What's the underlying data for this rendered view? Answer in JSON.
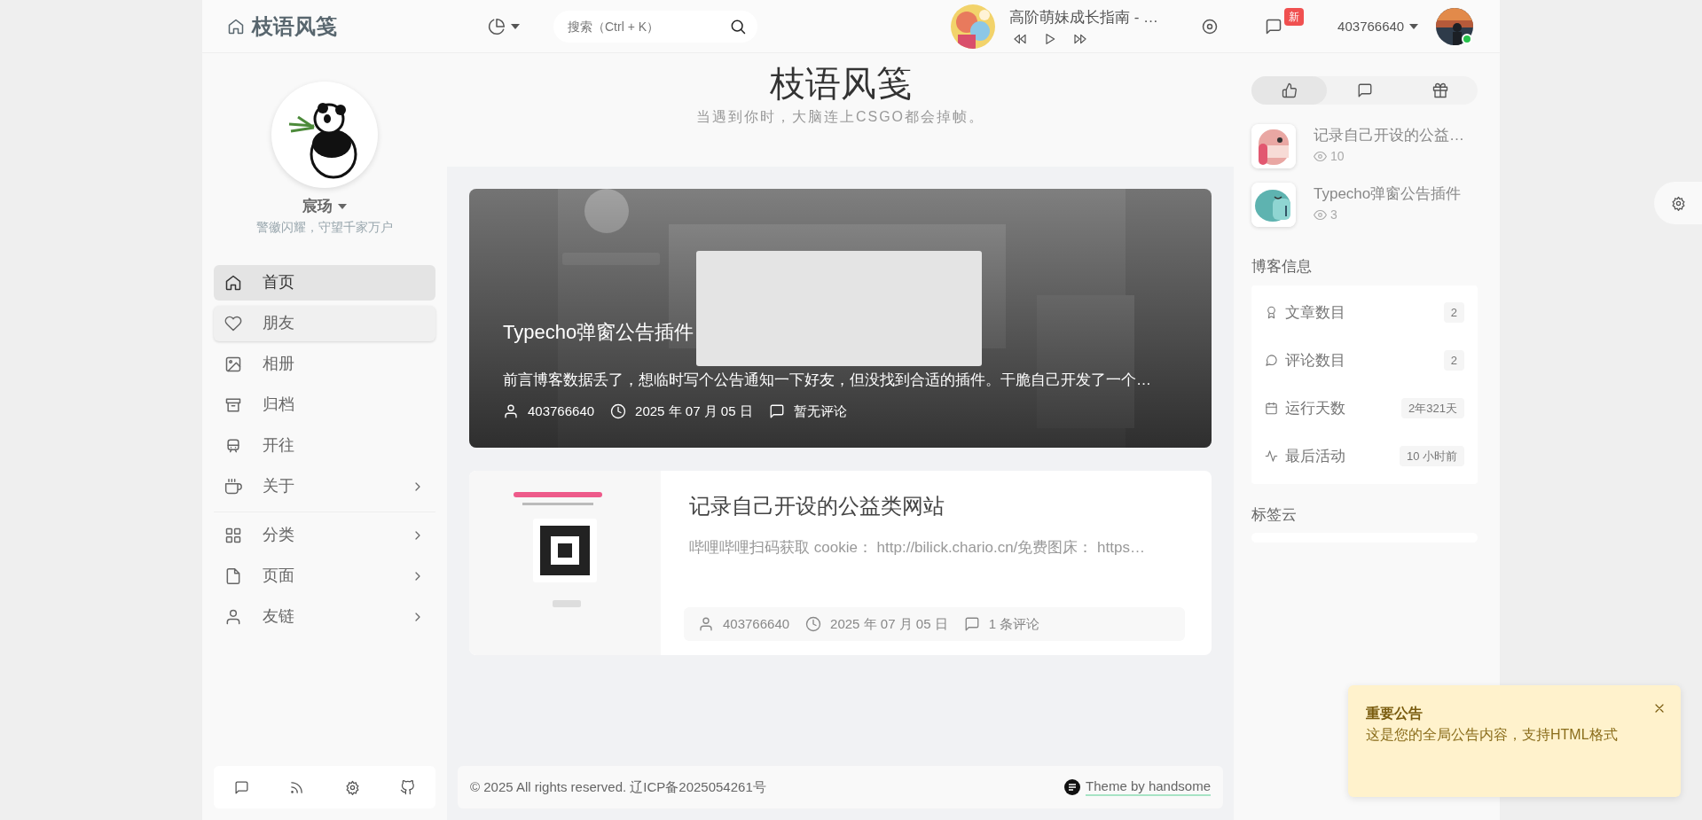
{
  "header": {
    "brand": "枝语风笺",
    "search": {
      "placeholder": "搜索（Ctrl + K）"
    },
    "music": {
      "title": "高阶萌妹成长指南 - …"
    },
    "message_badge": "新",
    "username": "403766640",
    "online": true
  },
  "profile": {
    "name": "宸玚",
    "motto": "警徽闪耀，守望千家万户"
  },
  "nav_groups": [
    {
      "items": [
        {
          "label": "首页",
          "selected": true,
          "hovered": false,
          "submenu": false
        },
        {
          "label": "朋友",
          "selected": false,
          "hovered": true,
          "submenu": false
        },
        {
          "label": "相册",
          "selected": false,
          "hovered": false,
          "submenu": false
        },
        {
          "label": "归档",
          "selected": false,
          "hovered": false,
          "submenu": false
        },
        {
          "label": "开往",
          "selected": false,
          "hovered": false,
          "submenu": false
        },
        {
          "label": "关于",
          "selected": false,
          "hovered": false,
          "submenu": true
        }
      ]
    },
    {
      "items": [
        {
          "label": "分类",
          "selected": false,
          "hovered": false,
          "submenu": true
        },
        {
          "label": "页面",
          "selected": false,
          "hovered": false,
          "submenu": true
        },
        {
          "label": "友链",
          "selected": false,
          "hovered": false,
          "submenu": true
        }
      ]
    }
  ],
  "site": {
    "title": "枝语风笺",
    "tagline": "当遇到你时，大脑连上CSGO都会掉帧。"
  },
  "posts": [
    {
      "kind": "featured",
      "title": "Typecho弹窗公告插件",
      "excerpt": "前言博客数据丢了，想临时写个公告通知一下好友，但没找到合适的插件。干脆自己开发了一个…",
      "author": "403766640",
      "date": "2025 年 07 月 05 日",
      "comments": "暂无评论"
    },
    {
      "kind": "card",
      "title": "记录自己开设的公益类网站",
      "excerpt": "哔哩哔哩扫码获取 cookie： http://bilick.chario.cn/免费图床： https…",
      "author": "403766640",
      "date": "2025 年 07 月 05 日",
      "comments": "1 条评论"
    }
  ],
  "footer": {
    "copyright": "© 2025 All rights reserved. 辽ICP备2025054261号",
    "theme_link": "Theme by handsome"
  },
  "side_tabs": [
    {
      "selected": true
    },
    {
      "selected": false
    },
    {
      "selected": false
    }
  ],
  "popular": [
    {
      "title": "记录自己开设的公益…",
      "views": "10"
    },
    {
      "title": "Typecho弹窗公告插件",
      "views": "3"
    }
  ],
  "blog_info": {
    "title": "博客信息",
    "rows": [
      {
        "label": "文章数目",
        "value": "2"
      },
      {
        "label": "评论数目",
        "value": "2"
      },
      {
        "label": "运行天数",
        "value": "2年321天"
      },
      {
        "label": "最后活动",
        "value": "10 小时前"
      }
    ]
  },
  "tag_cloud": {
    "title": "标签云"
  },
  "notice": {
    "title": "重要公告",
    "body": "这是您的全局公告内容，支持HTML格式"
  }
}
